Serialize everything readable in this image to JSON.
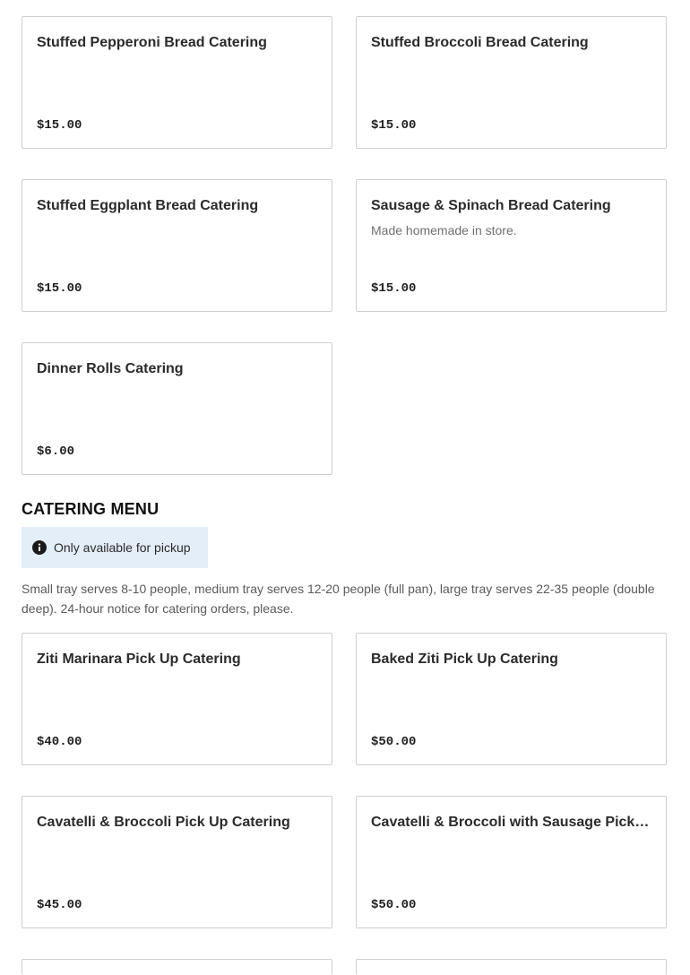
{
  "bread_items": [
    {
      "name": "Stuffed Pepperoni Bread Catering",
      "description": "",
      "price": "$15.00"
    },
    {
      "name": "Stuffed Broccoli Bread Catering",
      "description": "",
      "price": "$15.00"
    },
    {
      "name": "Stuffed Eggplant Bread Catering",
      "description": "",
      "price": "$15.00"
    },
    {
      "name": "Sausage & Spinach Bread Catering",
      "description": "Made homemade in store.",
      "price": "$15.00"
    },
    {
      "name": "Dinner Rolls Catering",
      "description": "",
      "price": "$6.00"
    }
  ],
  "catering_menu": {
    "title": "CATERING MENU",
    "notice": "Only available for pickup",
    "notice_icon": "info-icon",
    "description": "Small tray serves 8-10 people, medium tray serves 12-20 people (full pan), large tray serves 22-35 people (double deep). 24-hour notice for catering orders, please.",
    "items": [
      {
        "name": "Ziti Marinara Pick Up Catering",
        "description": "",
        "price": "$40.00"
      },
      {
        "name": "Baked Ziti Pick Up Catering",
        "description": "",
        "price": "$50.00"
      },
      {
        "name": "Cavatelli & Broccoli Pick Up Catering",
        "description": "",
        "price": "$45.00"
      },
      {
        "name": "Cavatelli & Broccoli with Sausage Pick U...",
        "description": "",
        "price": "$50.00"
      }
    ]
  },
  "colors": {
    "card_border": "#cfcfcf",
    "notice_background": "#e4eef9",
    "muted_text": "#6f6f6f"
  }
}
